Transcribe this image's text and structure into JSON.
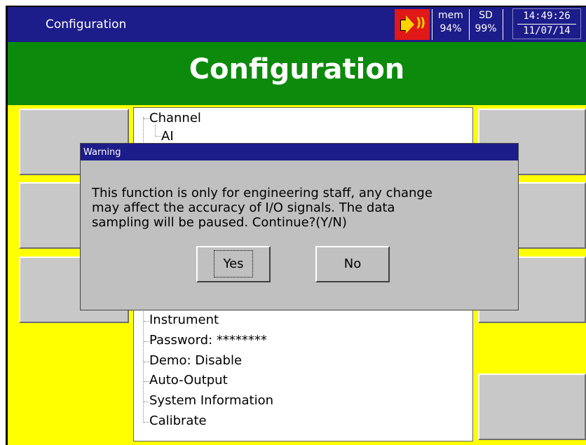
{
  "titlebar": {
    "title": "Configuration",
    "mem_label": "mem",
    "mem_value": "94%",
    "sd_label": "SD",
    "sd_value": "99%",
    "time": "14:49:26",
    "date": "11/07/14",
    "speaker_icon": "speaker-icon"
  },
  "banner": {
    "heading": "Configuration"
  },
  "tree": {
    "items": [
      "Channel",
      "AI",
      "Instrument",
      "Password: ********",
      "Demo: Disable",
      "Auto-Output",
      "System Information",
      "Calibrate"
    ]
  },
  "dialog": {
    "title": "Warning",
    "message_line1": "This function is only for engineering staff, any change",
    "message_line2": "may affect the accuracy of I/O signals. The data",
    "message_line3": "sampling will be paused. Continue?(Y/N)",
    "yes_label": "Yes",
    "no_label": "No"
  },
  "colors": {
    "titlebar": "#1C1C8A",
    "banner": "#0C8A0C",
    "background": "#FFFF00",
    "button": "#C8C8C8",
    "alert": "#E01818"
  }
}
